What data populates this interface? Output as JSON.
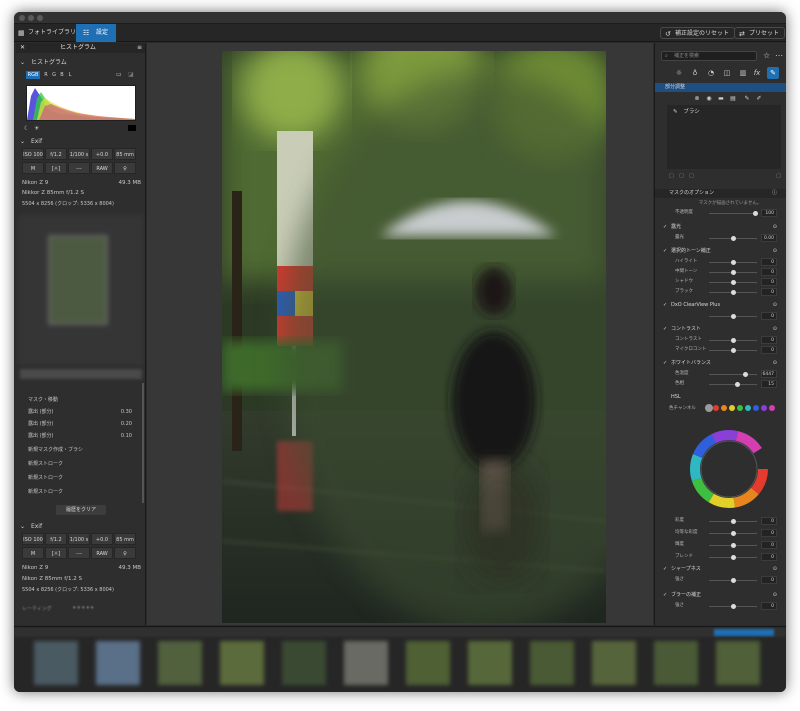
{
  "toolbar": {
    "library_label": "フォトライブラリ",
    "settings_label": "設定",
    "reset_label": "補正設定のリセット",
    "preset_label": "プリセット"
  },
  "left_panel": {
    "header": "ヒストグラム",
    "histogram_title": "ヒストグラム",
    "channels": [
      "RGB",
      "R",
      "G",
      "B",
      "L"
    ],
    "exif_title": "Exif",
    "exif_values": [
      "ISO 100",
      "f/1.2",
      "1/100 s",
      "+0.0 EV",
      "85 mm"
    ],
    "exif_icons": [
      "M",
      "[☼]",
      "---",
      "RAW",
      "♀"
    ],
    "camera": "Nikon Z 9",
    "megapixels": "49.3 MB",
    "lens": "Nikkor Z 85mm f/1.2 S",
    "dimensions": "5504 x 8256 (クロップ: 5336 x 8004)",
    "history_items": [
      {
        "label": "マスク・移動",
        "value": ""
      },
      {
        "label": "露出 (部分)",
        "value": "0.30"
      },
      {
        "label": "露出 (部分)",
        "value": "0.20"
      },
      {
        "label": "露出 (部分)",
        "value": "0.10"
      },
      {
        "label": "新規マスク作成・ブラシ",
        "value": ""
      },
      {
        "label": "新規ストローク",
        "value": ""
      },
      {
        "label": "新規ストローク",
        "value": ""
      },
      {
        "label": "新規ストローク",
        "value": ""
      }
    ],
    "clear_history": "履歴をクリア",
    "exif2_title": "Exif",
    "camera2": "Nikon Z 9",
    "megapixels2": "49.3 MB",
    "lens2": "Nikon Z 85mm f/1.2 S",
    "dimensions2": "5504 x 8256 (クロップ: 5336 x 8004)",
    "rating_label": "レーティング"
  },
  "right_panel": {
    "search_placeholder": "補正を検索",
    "adjust_header": "部分調整",
    "brush_label": "ブラシ",
    "mask_options": "マスクのオプション",
    "mask_hint": "マスクが描画されていません。",
    "opacity_label": "不透明度",
    "opacity_value": "100",
    "sections": [
      {
        "title": "露光",
        "rows": [
          {
            "label": "露光",
            "value": "0.00",
            "knob": 0.5
          }
        ]
      },
      {
        "title": "選択的トーン補正",
        "rows": [
          {
            "label": "ハイライト",
            "value": "0",
            "knob": 0.5
          },
          {
            "label": "中間トーン",
            "value": "0",
            "knob": 0.5
          },
          {
            "label": "シャドウ",
            "value": "0",
            "knob": 0.5
          },
          {
            "label": "ブラック",
            "value": "0",
            "knob": 0.5
          }
        ]
      },
      {
        "title": "DxO ClearView Plus",
        "rows": [
          {
            "label": "",
            "value": "0",
            "knob": 0.5
          }
        ]
      },
      {
        "title": "コントラスト",
        "rows": [
          {
            "label": "コントラスト",
            "value": "0",
            "knob": 0.5
          },
          {
            "label": "マイクロコントラスト",
            "value": "0",
            "knob": 0.5
          }
        ]
      },
      {
        "title": "ホワイトバランス",
        "rows": [
          {
            "label": "色温度",
            "value": "6447",
            "knob": 0.75
          },
          {
            "label": "色相",
            "value": "15",
            "knob": 0.6
          }
        ]
      }
    ],
    "hsl_title": "HSL",
    "hsl_channel_label": "色チャンネル",
    "hsl_colors": [
      "#9a9a9a",
      "#e53b2e",
      "#e8861d",
      "#e3cf2a",
      "#3fbf3f",
      "#2fb7c2",
      "#2f5fdc",
      "#8a3fd8",
      "#d33fb0"
    ],
    "hsl_rows": [
      {
        "label": "彩度",
        "value": "0",
        "knob": 0.5
      },
      {
        "label": "均等な彩度",
        "value": "0",
        "knob": 0.5
      },
      {
        "label": "輝度",
        "value": "0",
        "knob": 0.5
      },
      {
        "label": "ブレンド",
        "value": "0",
        "knob": 0.5
      }
    ],
    "sharp_title": "シャープネス",
    "sharp_rows": [
      {
        "label": "強さ",
        "value": "0",
        "knob": 0.5
      }
    ],
    "blur_title": "ブラーの補正",
    "blur_rows": [
      {
        "label": "強さ",
        "value": "0",
        "knob": 0.5
      }
    ]
  }
}
